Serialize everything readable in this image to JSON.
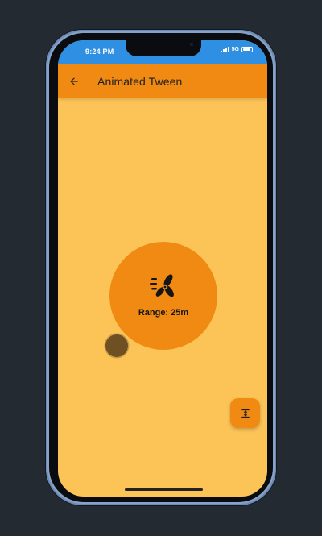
{
  "status_bar": {
    "time": "9:24 PM",
    "network": "5G",
    "signal_icon": "signal-bars-icon",
    "battery_icon": "battery-icon"
  },
  "app_bar": {
    "title": "Animated Tween",
    "back_icon": "arrow-left-icon"
  },
  "range_indicator": {
    "label": "Range: 25m",
    "icon": "drone-fan-icon"
  },
  "fab": {
    "icon": "vertical-expand-icon"
  },
  "colors": {
    "background": "#fcc457",
    "accent": "#f08a13",
    "status_bar": "#2f8fe3",
    "handle": "#6e5023"
  }
}
